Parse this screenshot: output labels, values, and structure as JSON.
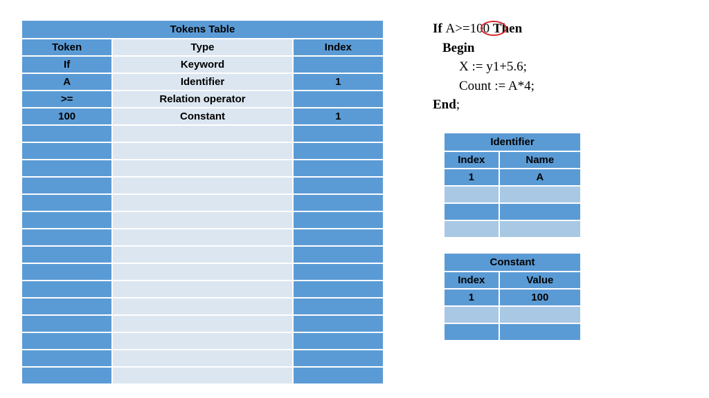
{
  "tokens_table": {
    "title": "Tokens Table",
    "headers": [
      "Token",
      "Type",
      "Index"
    ],
    "rows": [
      {
        "token": "If",
        "type": "Keyword",
        "index": ""
      },
      {
        "token": "A",
        "type": "Identifier",
        "index": "1"
      },
      {
        "token": ">=",
        "type": "Relation operator",
        "index": ""
      },
      {
        "token": "100",
        "type": "Constant",
        "index": "1"
      }
    ],
    "empty_rows": 15
  },
  "code": {
    "line1a": "If ",
    "line1b": "A>=",
    "line1c": "100 ",
    "line1d": "Then",
    "line2": "Begin",
    "line3": "X := y1+5.6;",
    "line4": "Count := A*4;",
    "line5a": "End",
    "line5b": ";"
  },
  "identifier_table": {
    "title": "Identifier",
    "headers": [
      "Index",
      "Name"
    ],
    "rows": [
      {
        "index": "1",
        "name": "A"
      }
    ],
    "empty_rows": 3
  },
  "constant_table": {
    "title": "Constant",
    "headers": [
      "Index",
      "Value"
    ],
    "rows": [
      {
        "index": "1",
        "value": "100"
      }
    ],
    "empty_rows": 2
  }
}
